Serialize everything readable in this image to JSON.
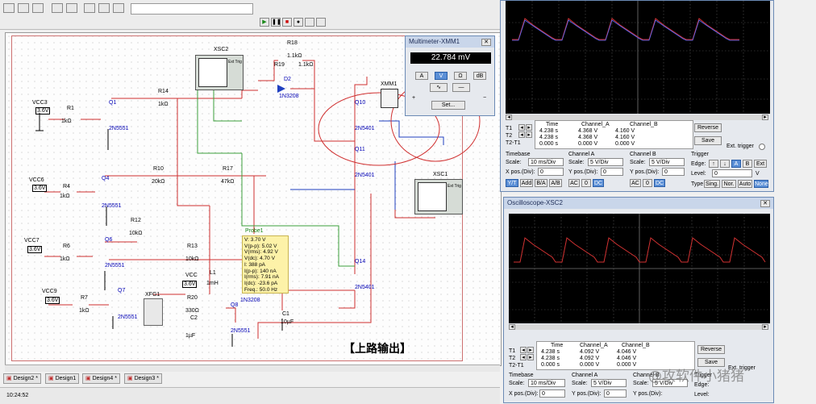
{
  "tabs": [
    "Design2 *",
    "Design1",
    "Design4 *",
    "Design3 *"
  ],
  "status_time": "10:24:52",
  "multimeter": {
    "title": "Multimeter-XMM1",
    "reading": "22.784 mV",
    "modes": [
      "A",
      "V",
      "Ω",
      "dB"
    ],
    "set_label": "Set...",
    "plus": "+",
    "minus": "−"
  },
  "scope1": {
    "cursor_labels": [
      "T1",
      "T2",
      "T2-T1"
    ],
    "headers": [
      "Time",
      "Channel_A",
      "Channel_B"
    ],
    "rows": [
      [
        "4.238 s",
        "4.368 V",
        "4.160 V"
      ],
      [
        "4.238 s",
        "4.368 V",
        "4.160 V"
      ],
      [
        "0.000 s",
        "0.000 V",
        "0.000 V"
      ]
    ],
    "reverse": "Reverse",
    "save": "Save",
    "ext_trigger": "Ext. trigger",
    "timebase": "Timebase",
    "channel_a": "Channel A",
    "channel_b": "Channel B",
    "trigger": "Trigger",
    "scale_lbl": "Scale:",
    "xpos_lbl": "X pos.(Div):",
    "ypos_lbl": "Y pos.(Div):",
    "tb_scale": "10 ms/Div",
    "tb_xpos": "0",
    "cha_scale": "5 V/Div",
    "cha_ypos": "0",
    "chb_scale": "5 V/Div",
    "chb_ypos": "0",
    "edge_lbl": "Edge:",
    "level_lbl": "Level:",
    "type_lbl": "Type",
    "level_val": "0",
    "level_unit": "V",
    "tb_btns": [
      "Y/T",
      "Add",
      "B/A",
      "A/B"
    ],
    "ch_btns": [
      "AC",
      "0",
      "DC"
    ],
    "trig_edge_btns": [
      "A",
      "B",
      "Ext"
    ],
    "trig_type_btns": [
      "Sing.",
      "Nor.",
      "Auto",
      "None"
    ]
  },
  "scope2": {
    "title": "Oscilloscope-XSC2",
    "cursor_labels": [
      "T1",
      "T2",
      "T2-T1"
    ],
    "headers": [
      "Time",
      "Channel_A",
      "Channel_B"
    ],
    "rows": [
      [
        "4.238 s",
        "4.092 V",
        "4.046 V"
      ],
      [
        "4.238 s",
        "4.092 V",
        "4.046 V"
      ],
      [
        "0.000 s",
        "0.000 V",
        "0.000 V"
      ]
    ],
    "reverse": "Reverse",
    "save": "Save",
    "ext_trigger": "Ext. trigger",
    "timebase": "Timebase",
    "channel_a": "Channel A",
    "channel_b": "Channel B",
    "trigger": "Trigger",
    "scale_lbl": "Scale:",
    "xpos_lbl": "X pos.(Div):",
    "ypos_lbl": "Y pos.(Div):",
    "tb_scale": "10 ms/Div",
    "tb_xpos": "0",
    "cha_scale": "5 V/Div",
    "cha_ypos": "0",
    "chb_scale": "5 V/Div",
    "edge_lbl": "Edge:",
    "level_lbl": "Level:"
  },
  "probe": {
    "name": "Probe1",
    "lines": [
      "V: 3.70 V",
      "V(p-p): 5.02 V",
      "V(rms): 4.92 V",
      "V(dc): 4.70 V",
      "I: 388 pA",
      "I(p-p): 140 nA",
      "I(rms): 7.91 nA",
      "I(dc): -23.6 pA",
      "Freq.: 50.0 Hz"
    ]
  },
  "schematic": {
    "instr_xsc2": "XSC2",
    "instr_xsc1": "XSC1",
    "instr_xmm1": "XMM1",
    "instr_xfg1": "XFG1",
    "ext_trig": "Ext Trig",
    "caption": "【上路输出】",
    "transistors": [
      "Q1",
      "Q4",
      "Q6",
      "Q7",
      "Q8",
      "Q10",
      "Q11",
      "Q14"
    ],
    "part_2n5551": "2N5551",
    "part_2n5401": "2N5401",
    "part_1n3208": "1N3208",
    "vcc_labels": [
      "VCC3",
      "VCC6",
      "VCC7",
      "VCC9",
      "VCC"
    ],
    "vcc_val": "3.6V",
    "resistors": [
      [
        "R1",
        "1kΩ"
      ],
      [
        "R4",
        "1kΩ"
      ],
      [
        "R6",
        "1kΩ"
      ],
      [
        "R7",
        "1kΩ"
      ],
      [
        "R14",
        "1kΩ"
      ],
      [
        "R10",
        "20kΩ"
      ],
      [
        "R17",
        "47kΩ"
      ],
      [
        "R12",
        "10kΩ"
      ],
      [
        "R13",
        "10kΩ"
      ],
      [
        "R18",
        "1.1kΩ"
      ],
      [
        "R19",
        "1.1kΩ"
      ],
      [
        "R20",
        "330Ω"
      ]
    ],
    "l1": "L1",
    "l1_val": "1mH",
    "c1": "C1",
    "c1_val": "10µF",
    "c2": "C2",
    "c2_val": "1µF",
    "d2": "D2"
  },
  "watermark": "@攻软件小猪猪",
  "colors": {
    "trace_red": "#d23232",
    "trace_blue": "#5a6cff",
    "wire_red": "#d03030",
    "wire_green": "#3aa03a",
    "wire_blue": "#2040c0",
    "annot": "#d03030"
  }
}
